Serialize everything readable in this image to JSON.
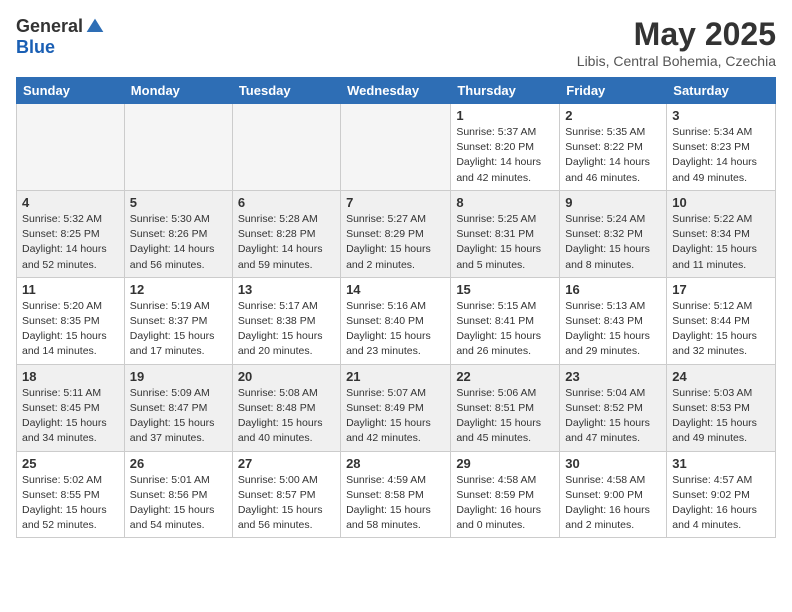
{
  "logo": {
    "general": "General",
    "blue": "Blue"
  },
  "title": "May 2025",
  "location": "Libis, Central Bohemia, Czechia",
  "days_header": [
    "Sunday",
    "Monday",
    "Tuesday",
    "Wednesday",
    "Thursday",
    "Friday",
    "Saturday"
  ],
  "weeks": [
    [
      {
        "day": "",
        "info": ""
      },
      {
        "day": "",
        "info": ""
      },
      {
        "day": "",
        "info": ""
      },
      {
        "day": "",
        "info": ""
      },
      {
        "day": "1",
        "info": "Sunrise: 5:37 AM\nSunset: 8:20 PM\nDaylight: 14 hours\nand 42 minutes."
      },
      {
        "day": "2",
        "info": "Sunrise: 5:35 AM\nSunset: 8:22 PM\nDaylight: 14 hours\nand 46 minutes."
      },
      {
        "day": "3",
        "info": "Sunrise: 5:34 AM\nSunset: 8:23 PM\nDaylight: 14 hours\nand 49 minutes."
      }
    ],
    [
      {
        "day": "4",
        "info": "Sunrise: 5:32 AM\nSunset: 8:25 PM\nDaylight: 14 hours\nand 52 minutes."
      },
      {
        "day": "5",
        "info": "Sunrise: 5:30 AM\nSunset: 8:26 PM\nDaylight: 14 hours\nand 56 minutes."
      },
      {
        "day": "6",
        "info": "Sunrise: 5:28 AM\nSunset: 8:28 PM\nDaylight: 14 hours\nand 59 minutes."
      },
      {
        "day": "7",
        "info": "Sunrise: 5:27 AM\nSunset: 8:29 PM\nDaylight: 15 hours\nand 2 minutes."
      },
      {
        "day": "8",
        "info": "Sunrise: 5:25 AM\nSunset: 8:31 PM\nDaylight: 15 hours\nand 5 minutes."
      },
      {
        "day": "9",
        "info": "Sunrise: 5:24 AM\nSunset: 8:32 PM\nDaylight: 15 hours\nand 8 minutes."
      },
      {
        "day": "10",
        "info": "Sunrise: 5:22 AM\nSunset: 8:34 PM\nDaylight: 15 hours\nand 11 minutes."
      }
    ],
    [
      {
        "day": "11",
        "info": "Sunrise: 5:20 AM\nSunset: 8:35 PM\nDaylight: 15 hours\nand 14 minutes."
      },
      {
        "day": "12",
        "info": "Sunrise: 5:19 AM\nSunset: 8:37 PM\nDaylight: 15 hours\nand 17 minutes."
      },
      {
        "day": "13",
        "info": "Sunrise: 5:17 AM\nSunset: 8:38 PM\nDaylight: 15 hours\nand 20 minutes."
      },
      {
        "day": "14",
        "info": "Sunrise: 5:16 AM\nSunset: 8:40 PM\nDaylight: 15 hours\nand 23 minutes."
      },
      {
        "day": "15",
        "info": "Sunrise: 5:15 AM\nSunset: 8:41 PM\nDaylight: 15 hours\nand 26 minutes."
      },
      {
        "day": "16",
        "info": "Sunrise: 5:13 AM\nSunset: 8:43 PM\nDaylight: 15 hours\nand 29 minutes."
      },
      {
        "day": "17",
        "info": "Sunrise: 5:12 AM\nSunset: 8:44 PM\nDaylight: 15 hours\nand 32 minutes."
      }
    ],
    [
      {
        "day": "18",
        "info": "Sunrise: 5:11 AM\nSunset: 8:45 PM\nDaylight: 15 hours\nand 34 minutes."
      },
      {
        "day": "19",
        "info": "Sunrise: 5:09 AM\nSunset: 8:47 PM\nDaylight: 15 hours\nand 37 minutes."
      },
      {
        "day": "20",
        "info": "Sunrise: 5:08 AM\nSunset: 8:48 PM\nDaylight: 15 hours\nand 40 minutes."
      },
      {
        "day": "21",
        "info": "Sunrise: 5:07 AM\nSunset: 8:49 PM\nDaylight: 15 hours\nand 42 minutes."
      },
      {
        "day": "22",
        "info": "Sunrise: 5:06 AM\nSunset: 8:51 PM\nDaylight: 15 hours\nand 45 minutes."
      },
      {
        "day": "23",
        "info": "Sunrise: 5:04 AM\nSunset: 8:52 PM\nDaylight: 15 hours\nand 47 minutes."
      },
      {
        "day": "24",
        "info": "Sunrise: 5:03 AM\nSunset: 8:53 PM\nDaylight: 15 hours\nand 49 minutes."
      }
    ],
    [
      {
        "day": "25",
        "info": "Sunrise: 5:02 AM\nSunset: 8:55 PM\nDaylight: 15 hours\nand 52 minutes."
      },
      {
        "day": "26",
        "info": "Sunrise: 5:01 AM\nSunset: 8:56 PM\nDaylight: 15 hours\nand 54 minutes."
      },
      {
        "day": "27",
        "info": "Sunrise: 5:00 AM\nSunset: 8:57 PM\nDaylight: 15 hours\nand 56 minutes."
      },
      {
        "day": "28",
        "info": "Sunrise: 4:59 AM\nSunset: 8:58 PM\nDaylight: 15 hours\nand 58 minutes."
      },
      {
        "day": "29",
        "info": "Sunrise: 4:58 AM\nSunset: 8:59 PM\nDaylight: 16 hours\nand 0 minutes."
      },
      {
        "day": "30",
        "info": "Sunrise: 4:58 AM\nSunset: 9:00 PM\nDaylight: 16 hours\nand 2 minutes."
      },
      {
        "day": "31",
        "info": "Sunrise: 4:57 AM\nSunset: 9:02 PM\nDaylight: 16 hours\nand 4 minutes."
      }
    ]
  ]
}
